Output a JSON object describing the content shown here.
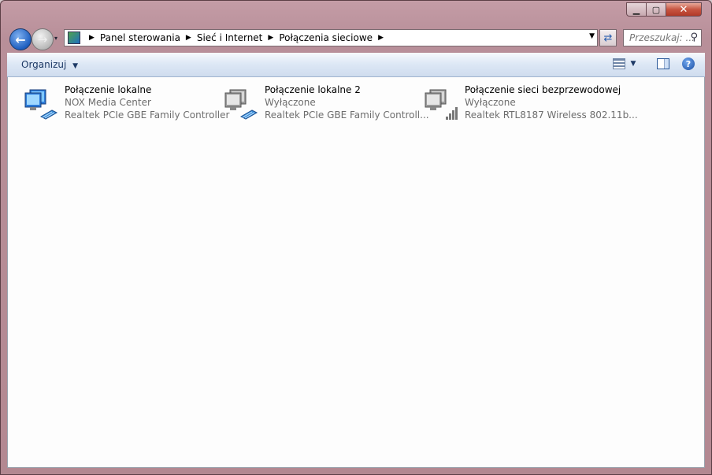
{
  "window": {
    "minimize": "▁",
    "maximize": "▢",
    "close": "✕"
  },
  "nav": {
    "back": "←",
    "forward": "→",
    "recent": "▾",
    "breadcrumb": [
      "Panel sterowania",
      "Sieć i Internet",
      "Połączenia sieciowe"
    ],
    "refresh": "⇄",
    "search_placeholder": "Przeszukaj: ..."
  },
  "toolbar": {
    "organize": "Organizuj",
    "help": "?"
  },
  "connections": [
    {
      "name": "Połączenie lokalne",
      "status": "NOX Media Center",
      "device": "Realtek PCIe GBE Family Controller",
      "type": "wired",
      "enabled": true
    },
    {
      "name": "Połączenie lokalne 2",
      "status": "Wyłączone",
      "device": "Realtek PCIe GBE Family Controll...",
      "type": "wired",
      "enabled": false
    },
    {
      "name": "Połączenie sieci bezprzewodowej",
      "status": "Wyłączone",
      "device": "Realtek RTL8187 Wireless 802.11b...",
      "type": "wireless",
      "enabled": false
    }
  ],
  "colors": {
    "frame": "#b88f99",
    "toolbar": "#dce7f5",
    "text_secondary": "#6d6d6d"
  }
}
